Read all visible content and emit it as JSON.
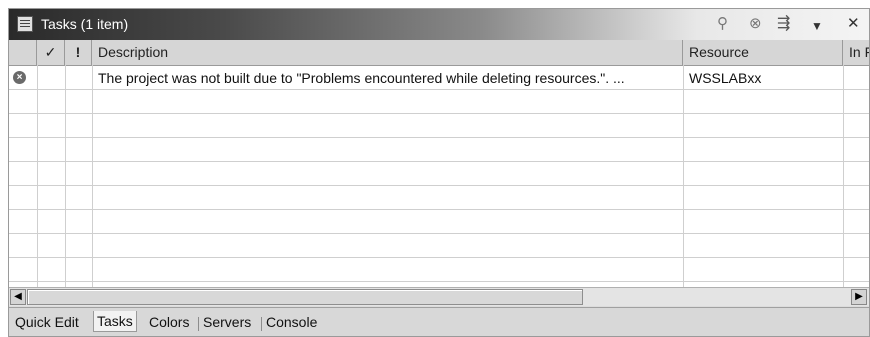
{
  "window": {
    "title": "Tasks (1 item)",
    "toolbar_icons": [
      "filter-icon",
      "delete-completed-icon",
      "sort-icon",
      "view-menu-icon",
      "close-icon"
    ]
  },
  "columns": {
    "completed": "✓",
    "priority": "!",
    "description": "Description",
    "resource": "Resource",
    "in_folder": "In F"
  },
  "rows": [
    {
      "icon": "error-icon",
      "description": "The project was not built due to \"Problems encountered while deleting resources.\". ...",
      "resource": "WSSLABxx"
    }
  ],
  "tabs": [
    {
      "label": "Quick Edit",
      "active": false
    },
    {
      "label": "Tasks",
      "active": true
    },
    {
      "label": "Colors",
      "active": false
    },
    {
      "label": "Servers",
      "active": false
    },
    {
      "label": "Console",
      "active": false
    }
  ],
  "colors": {
    "titlebar_dark": "#2a2a2a",
    "titlebar_light": "#f4f4f4",
    "panel_bg": "#dcdcdc"
  }
}
